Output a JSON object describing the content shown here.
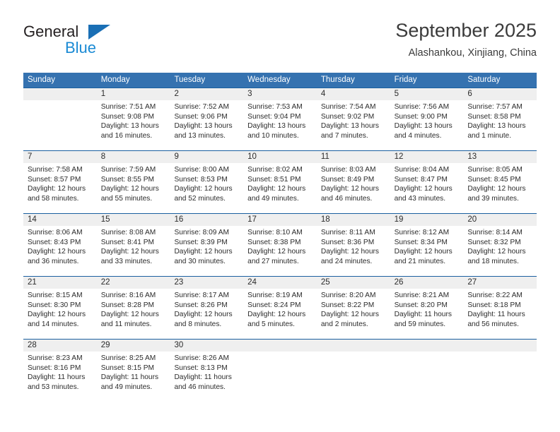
{
  "brand": {
    "name_top": "General",
    "name_bottom": "Blue",
    "triangle_color": "#1a6fb5",
    "blue_color": "#1a8ad4"
  },
  "header": {
    "title": "September 2025",
    "subtitle": "Alashankou, Xinjiang, China"
  },
  "theme": {
    "header_bg": "#3572b0",
    "row_divider": "#1a5fa0",
    "date_band_bg": "#efefef",
    "text": "#2b2b2b"
  },
  "calendar": {
    "weekday_headers": [
      "Sunday",
      "Monday",
      "Tuesday",
      "Wednesday",
      "Thursday",
      "Friday",
      "Saturday"
    ],
    "weeks": [
      {
        "dates": [
          "",
          "1",
          "2",
          "3",
          "4",
          "5",
          "6"
        ],
        "cells": [
          {
            "sunrise": "",
            "sunset": "",
            "daylight_l1": "",
            "daylight_l2": ""
          },
          {
            "sunrise": "Sunrise: 7:51 AM",
            "sunset": "Sunset: 9:08 PM",
            "daylight_l1": "Daylight: 13 hours",
            "daylight_l2": "and 16 minutes."
          },
          {
            "sunrise": "Sunrise: 7:52 AM",
            "sunset": "Sunset: 9:06 PM",
            "daylight_l1": "Daylight: 13 hours",
            "daylight_l2": "and 13 minutes."
          },
          {
            "sunrise": "Sunrise: 7:53 AM",
            "sunset": "Sunset: 9:04 PM",
            "daylight_l1": "Daylight: 13 hours",
            "daylight_l2": "and 10 minutes."
          },
          {
            "sunrise": "Sunrise: 7:54 AM",
            "sunset": "Sunset: 9:02 PM",
            "daylight_l1": "Daylight: 13 hours",
            "daylight_l2": "and 7 minutes."
          },
          {
            "sunrise": "Sunrise: 7:56 AM",
            "sunset": "Sunset: 9:00 PM",
            "daylight_l1": "Daylight: 13 hours",
            "daylight_l2": "and 4 minutes."
          },
          {
            "sunrise": "Sunrise: 7:57 AM",
            "sunset": "Sunset: 8:58 PM",
            "daylight_l1": "Daylight: 13 hours",
            "daylight_l2": "and 1 minute."
          }
        ]
      },
      {
        "dates": [
          "7",
          "8",
          "9",
          "10",
          "11",
          "12",
          "13"
        ],
        "cells": [
          {
            "sunrise": "Sunrise: 7:58 AM",
            "sunset": "Sunset: 8:57 PM",
            "daylight_l1": "Daylight: 12 hours",
            "daylight_l2": "and 58 minutes."
          },
          {
            "sunrise": "Sunrise: 7:59 AM",
            "sunset": "Sunset: 8:55 PM",
            "daylight_l1": "Daylight: 12 hours",
            "daylight_l2": "and 55 minutes."
          },
          {
            "sunrise": "Sunrise: 8:00 AM",
            "sunset": "Sunset: 8:53 PM",
            "daylight_l1": "Daylight: 12 hours",
            "daylight_l2": "and 52 minutes."
          },
          {
            "sunrise": "Sunrise: 8:02 AM",
            "sunset": "Sunset: 8:51 PM",
            "daylight_l1": "Daylight: 12 hours",
            "daylight_l2": "and 49 minutes."
          },
          {
            "sunrise": "Sunrise: 8:03 AM",
            "sunset": "Sunset: 8:49 PM",
            "daylight_l1": "Daylight: 12 hours",
            "daylight_l2": "and 46 minutes."
          },
          {
            "sunrise": "Sunrise: 8:04 AM",
            "sunset": "Sunset: 8:47 PM",
            "daylight_l1": "Daylight: 12 hours",
            "daylight_l2": "and 43 minutes."
          },
          {
            "sunrise": "Sunrise: 8:05 AM",
            "sunset": "Sunset: 8:45 PM",
            "daylight_l1": "Daylight: 12 hours",
            "daylight_l2": "and 39 minutes."
          }
        ]
      },
      {
        "dates": [
          "14",
          "15",
          "16",
          "17",
          "18",
          "19",
          "20"
        ],
        "cells": [
          {
            "sunrise": "Sunrise: 8:06 AM",
            "sunset": "Sunset: 8:43 PM",
            "daylight_l1": "Daylight: 12 hours",
            "daylight_l2": "and 36 minutes."
          },
          {
            "sunrise": "Sunrise: 8:08 AM",
            "sunset": "Sunset: 8:41 PM",
            "daylight_l1": "Daylight: 12 hours",
            "daylight_l2": "and 33 minutes."
          },
          {
            "sunrise": "Sunrise: 8:09 AM",
            "sunset": "Sunset: 8:39 PM",
            "daylight_l1": "Daylight: 12 hours",
            "daylight_l2": "and 30 minutes."
          },
          {
            "sunrise": "Sunrise: 8:10 AM",
            "sunset": "Sunset: 8:38 PM",
            "daylight_l1": "Daylight: 12 hours",
            "daylight_l2": "and 27 minutes."
          },
          {
            "sunrise": "Sunrise: 8:11 AM",
            "sunset": "Sunset: 8:36 PM",
            "daylight_l1": "Daylight: 12 hours",
            "daylight_l2": "and 24 minutes."
          },
          {
            "sunrise": "Sunrise: 8:12 AM",
            "sunset": "Sunset: 8:34 PM",
            "daylight_l1": "Daylight: 12 hours",
            "daylight_l2": "and 21 minutes."
          },
          {
            "sunrise": "Sunrise: 8:14 AM",
            "sunset": "Sunset: 8:32 PM",
            "daylight_l1": "Daylight: 12 hours",
            "daylight_l2": "and 18 minutes."
          }
        ]
      },
      {
        "dates": [
          "21",
          "22",
          "23",
          "24",
          "25",
          "26",
          "27"
        ],
        "cells": [
          {
            "sunrise": "Sunrise: 8:15 AM",
            "sunset": "Sunset: 8:30 PM",
            "daylight_l1": "Daylight: 12 hours",
            "daylight_l2": "and 14 minutes."
          },
          {
            "sunrise": "Sunrise: 8:16 AM",
            "sunset": "Sunset: 8:28 PM",
            "daylight_l1": "Daylight: 12 hours",
            "daylight_l2": "and 11 minutes."
          },
          {
            "sunrise": "Sunrise: 8:17 AM",
            "sunset": "Sunset: 8:26 PM",
            "daylight_l1": "Daylight: 12 hours",
            "daylight_l2": "and 8 minutes."
          },
          {
            "sunrise": "Sunrise: 8:19 AM",
            "sunset": "Sunset: 8:24 PM",
            "daylight_l1": "Daylight: 12 hours",
            "daylight_l2": "and 5 minutes."
          },
          {
            "sunrise": "Sunrise: 8:20 AM",
            "sunset": "Sunset: 8:22 PM",
            "daylight_l1": "Daylight: 12 hours",
            "daylight_l2": "and 2 minutes."
          },
          {
            "sunrise": "Sunrise: 8:21 AM",
            "sunset": "Sunset: 8:20 PM",
            "daylight_l1": "Daylight: 11 hours",
            "daylight_l2": "and 59 minutes."
          },
          {
            "sunrise": "Sunrise: 8:22 AM",
            "sunset": "Sunset: 8:18 PM",
            "daylight_l1": "Daylight: 11 hours",
            "daylight_l2": "and 56 minutes."
          }
        ]
      },
      {
        "dates": [
          "28",
          "29",
          "30",
          "",
          "",
          "",
          ""
        ],
        "cells": [
          {
            "sunrise": "Sunrise: 8:23 AM",
            "sunset": "Sunset: 8:16 PM",
            "daylight_l1": "Daylight: 11 hours",
            "daylight_l2": "and 53 minutes."
          },
          {
            "sunrise": "Sunrise: 8:25 AM",
            "sunset": "Sunset: 8:15 PM",
            "daylight_l1": "Daylight: 11 hours",
            "daylight_l2": "and 49 minutes."
          },
          {
            "sunrise": "Sunrise: 8:26 AM",
            "sunset": "Sunset: 8:13 PM",
            "daylight_l1": "Daylight: 11 hours",
            "daylight_l2": "and 46 minutes."
          },
          {
            "sunrise": "",
            "sunset": "",
            "daylight_l1": "",
            "daylight_l2": ""
          },
          {
            "sunrise": "",
            "sunset": "",
            "daylight_l1": "",
            "daylight_l2": ""
          },
          {
            "sunrise": "",
            "sunset": "",
            "daylight_l1": "",
            "daylight_l2": ""
          },
          {
            "sunrise": "",
            "sunset": "",
            "daylight_l1": "",
            "daylight_l2": ""
          }
        ]
      }
    ]
  }
}
